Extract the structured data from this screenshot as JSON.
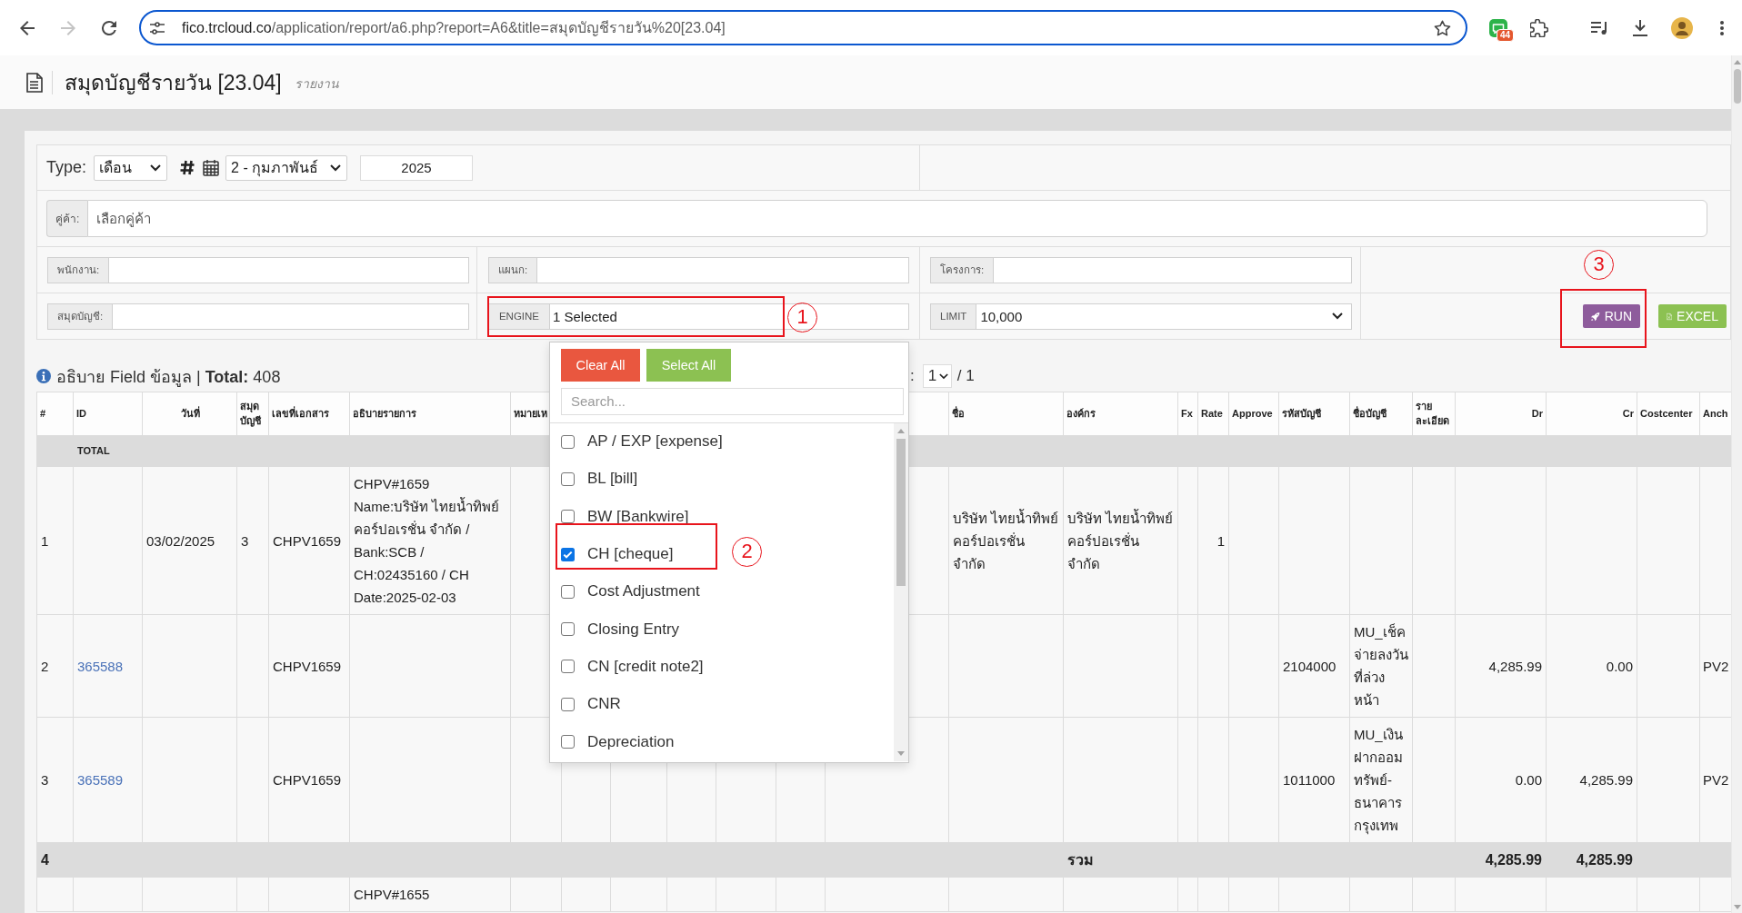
{
  "browser": {
    "nav_buttons": [
      {
        "kind": "back",
        "disabled": false
      },
      {
        "kind": "forward",
        "disabled": true
      },
      {
        "kind": "reload",
        "disabled": false
      }
    ],
    "address": {
      "host": "fico.trcloud.co",
      "path": "/application/report/a6.php?report=A6&title=สมุดบัญชีรายวัน%20[23.04]"
    },
    "extension_badge": "44"
  },
  "page": {
    "title": "สมุดบัญชีรายวัน [23.04]",
    "subtitle": "รายงาน"
  },
  "form": {
    "type": {
      "label": "Type:",
      "value": "เดือน"
    },
    "month": {
      "value": "2 - กุมภาพันธ์"
    },
    "year": {
      "value": "2025"
    },
    "partner": {
      "label": "คู่ค้า:",
      "placeholder": "เลือกคู่ค้า"
    },
    "staff": {
      "label": "พนักงาน:"
    },
    "department": {
      "label": "แผนก:"
    },
    "project": {
      "label": "โครงการ:"
    },
    "book": {
      "label": "สมุดบัญชี:"
    },
    "engine": {
      "label": "ENGINE",
      "value": "1 Selected",
      "annotation": "1",
      "expanded": true,
      "dropdown": {
        "clear_button": "Clear All",
        "select_all_button": "Select All",
        "search_placeholder": "Search...",
        "options": [
          {
            "label": "AP / EXP [expense]",
            "checked": false
          },
          {
            "label": "BL [bill]",
            "checked": false
          },
          {
            "label": "BW [Bankwire]",
            "checked": false
          },
          {
            "label": "CH [cheque]",
            "checked": true,
            "annotation": "2"
          },
          {
            "label": "Cost Adjustment",
            "checked": false
          },
          {
            "label": "Closing Entry",
            "checked": false
          },
          {
            "label": "CN [credit note2]",
            "checked": false
          },
          {
            "label": "CNR",
            "checked": false
          },
          {
            "label": "Depreciation",
            "checked": false
          }
        ]
      }
    },
    "limit": {
      "label": "LIMIT",
      "value": "10,000"
    },
    "buttons": [
      {
        "kind": "run",
        "label": "RUN",
        "annotation": "3"
      },
      {
        "kind": "excel",
        "label": "EXCEL"
      }
    ]
  },
  "summary": {
    "text": "อธิบาย Field ข้อมูล | **Total:** 408",
    "pagination": {
      "label": ":",
      "page": "1",
      "total": "/ 1"
    }
  },
  "table": {
    "columns": [
      "#",
      "ID",
      "วันที่",
      "สมุดบัญชี",
      "เลขที่เอกสาร",
      "อธิบายรายการ",
      "หมายเห",
      "ชื่อ",
      "องค์กร",
      "Fx",
      "Rate",
      "Approve",
      "รหัสบัญชี",
      "ชื่อบัญชี",
      "รายละเอียด",
      "Dr",
      "Cr",
      "Costcenter",
      "Anch"
    ],
    "rows": [
      {
        "kind": "total",
        "id": "TOTAL"
      },
      {
        "kind": "entry",
        "number": "1",
        "date": "03/02/2025",
        "book": "3",
        "doc_no": "CHPV1659",
        "description": "CHPV#1659 Name:บริษัท ไทยน้ำทิพย์ คอร์ปอเรชั่น จำกัด / Bank:SCB / CH:02435160 / CH Date:2025-02-03",
        "name": "บริษัท ไทยน้ำทิพย์ คอร์ปอเรชั่น จำกัด",
        "organization": "บริษัท ไทยน้ำทิพย์ คอร์ปอเรชั่น จำกัด",
        "rate": "1"
      },
      {
        "kind": "entry",
        "number": "2",
        "id": "365588",
        "doc_no": "CHPV1659",
        "account_code": "2104000",
        "account_name": "MU_เช็คจ่ายลงวันที่ล่วงหน้า",
        "dr": "4,285.99",
        "cr": "0.00",
        "anch": "PV2"
      },
      {
        "kind": "entry",
        "number": "3",
        "id": "365589",
        "doc_no": "CHPV1659",
        "account_code": "1011000",
        "account_name": "MU_เงินฝากออมทรัพย์-ธนาคารกรุงเทพ",
        "dr": "0.00",
        "cr": "4,285.99",
        "anch": "PV2"
      },
      {
        "kind": "subtotal",
        "number": "4",
        "organization": "รวม",
        "dr": "4,285.99",
        "cr": "4,285.99"
      },
      {
        "kind": "entry",
        "description": "CHPV#1655"
      }
    ]
  }
}
